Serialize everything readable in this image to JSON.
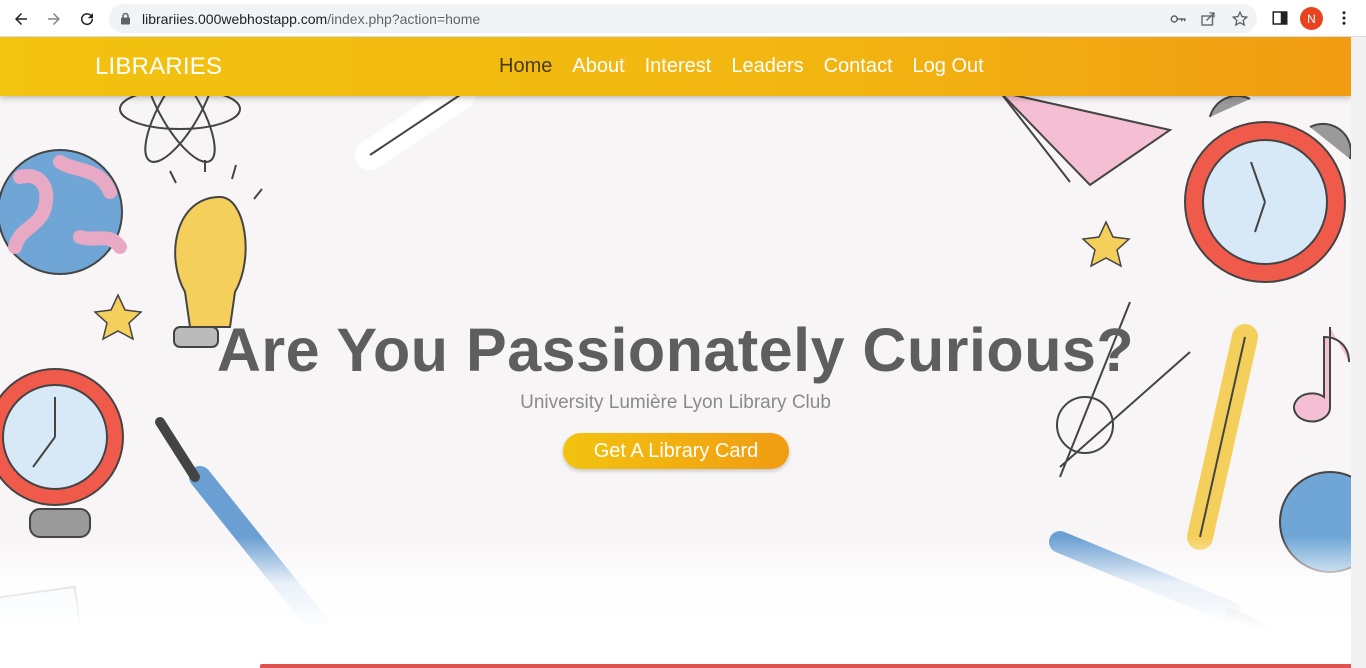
{
  "browser": {
    "url_host": "librariies.000webhostapp.com",
    "url_path": "/index.php?action=home",
    "profile_initial": "N",
    "icons": [
      "back-icon",
      "forward-icon",
      "reload-icon",
      "lock-icon",
      "key-icon",
      "share-icon",
      "star-icon",
      "side-panel-icon",
      "more-icon"
    ]
  },
  "navbar": {
    "brand": "LIBRARIES",
    "menu": [
      {
        "label": "Home",
        "active": true
      },
      {
        "label": "About",
        "active": false
      },
      {
        "label": "Interest",
        "active": false
      },
      {
        "label": "Leaders",
        "active": false
      },
      {
        "label": "Contact",
        "active": false
      },
      {
        "label": "Log Out",
        "active": false
      }
    ]
  },
  "hero": {
    "title": "Are You Passionately Curious?",
    "subtitle": "University Lumière Lyon Library Club",
    "cta_label": "Get A Library Card"
  },
  "colors": {
    "navbar_start": "#f2c30f",
    "navbar_end": "#f19c12",
    "title_text": "#5e5e5e",
    "accent_red": "#e25252"
  }
}
